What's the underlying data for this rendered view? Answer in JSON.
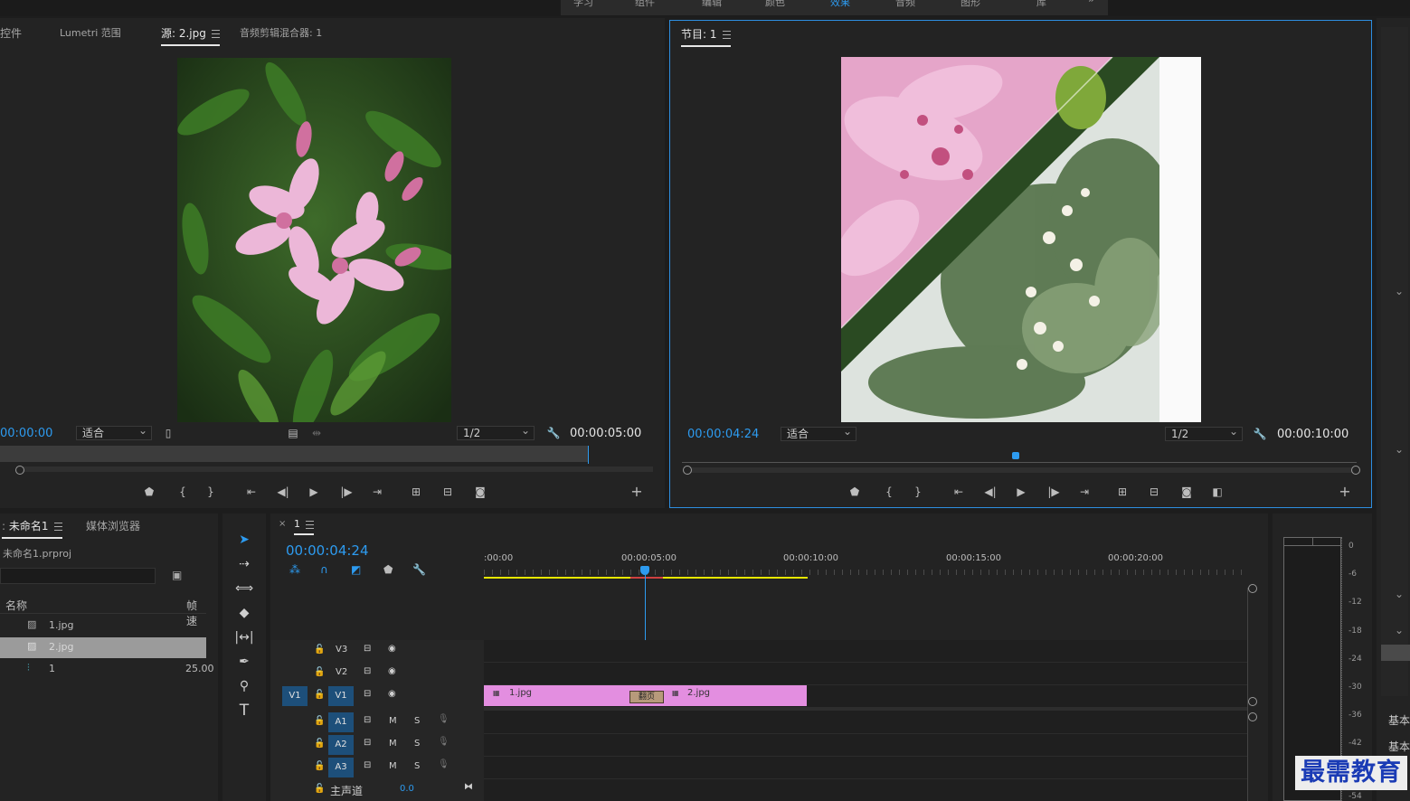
{
  "top_menu": {
    "items": [
      "学习",
      "组件",
      "编辑",
      "颜色",
      "效果",
      "音频",
      "图形",
      "库"
    ],
    "active": "效果"
  },
  "source_panel": {
    "tabs": [
      "控件",
      "Lumetri 范围",
      "源: 2.jpg",
      "音频剪辑混合器: 1"
    ],
    "timecode_in": "00:00:00",
    "fit": "适合",
    "resolution": "1/2",
    "duration": "00:00:05:00"
  },
  "program_panel": {
    "tab": "节目: 1",
    "timecode": "00:00:04:24",
    "fit": "适合",
    "resolution": "1/2",
    "duration": "00:00:10:00"
  },
  "project_panel": {
    "tabs": [
      "未命名1",
      "媒体浏览器"
    ],
    "project_file": "未命名1.prproj",
    "columns": [
      "名称",
      "帧速"
    ],
    "items": [
      {
        "name": "1.jpg",
        "rate": ""
      },
      {
        "name": "2.jpg",
        "rate": ""
      },
      {
        "name": "1",
        "rate": "25.00"
      }
    ]
  },
  "timeline": {
    "tab": "1",
    "timecode": "00:00:04:24",
    "ruler": [
      ":00:00",
      "00:00:05:00",
      "00:00:10:00",
      "00:00:15:00",
      "00:00:20:00"
    ],
    "video_tracks": [
      "V3",
      "V2",
      "V1"
    ],
    "source_patch": "V1",
    "audio_tracks": [
      "A1",
      "A2",
      "A3"
    ],
    "mute": "M",
    "solo": "S",
    "master_label": "主声道",
    "master_value": "0.0",
    "clips": [
      {
        "name": "1.jpg"
      },
      {
        "name": "2.jpg"
      }
    ],
    "transition_label": "翻页"
  },
  "audio_meter": {
    "labels": [
      "0",
      "-6",
      "-12",
      "-18",
      "-24",
      "-30",
      "-36",
      "-42",
      "-54"
    ]
  },
  "right_panel": {
    "items": [
      "基本",
      "基本"
    ]
  },
  "watermark": "最需教育",
  "colors": {
    "accent_blue": "#2d9bf0",
    "clip_pink": "#e38ee0",
    "work_area_yellow": "#e6e600",
    "target_blue": "#1d4f7a"
  }
}
